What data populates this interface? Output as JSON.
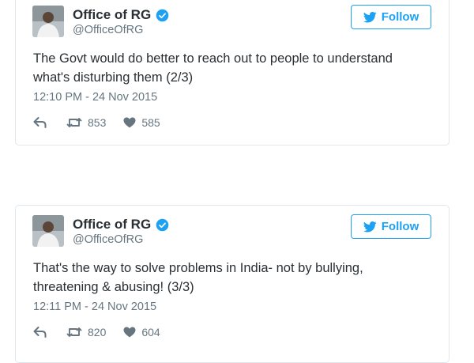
{
  "tweets": [
    {
      "author_name": "Office of RG",
      "handle": "@OfficeOfRG",
      "follow_label": "Follow",
      "text": "The Govt would do better to reach out to people to understand what's disturbing them (2/3)",
      "timestamp": "12:10 PM - 24 Nov 2015",
      "retweets": "853",
      "likes": "585"
    },
    {
      "author_name": "Office of RG",
      "handle": "@OfficeOfRG",
      "follow_label": "Follow",
      "text": "That's the way to solve problems in India- not by bullying, threatening & abusing! (3/3)",
      "timestamp": "12:11 PM - 24 Nov 2015",
      "retweets": "820",
      "likes": "604"
    }
  ],
  "colors": {
    "accent": "#1da1f2",
    "text": "#292f33",
    "muted": "#66757f",
    "border": "#e1e8ed"
  },
  "icons": [
    "verified-badge-icon",
    "twitter-bird-icon",
    "reply-icon",
    "retweet-icon",
    "heart-icon"
  ]
}
